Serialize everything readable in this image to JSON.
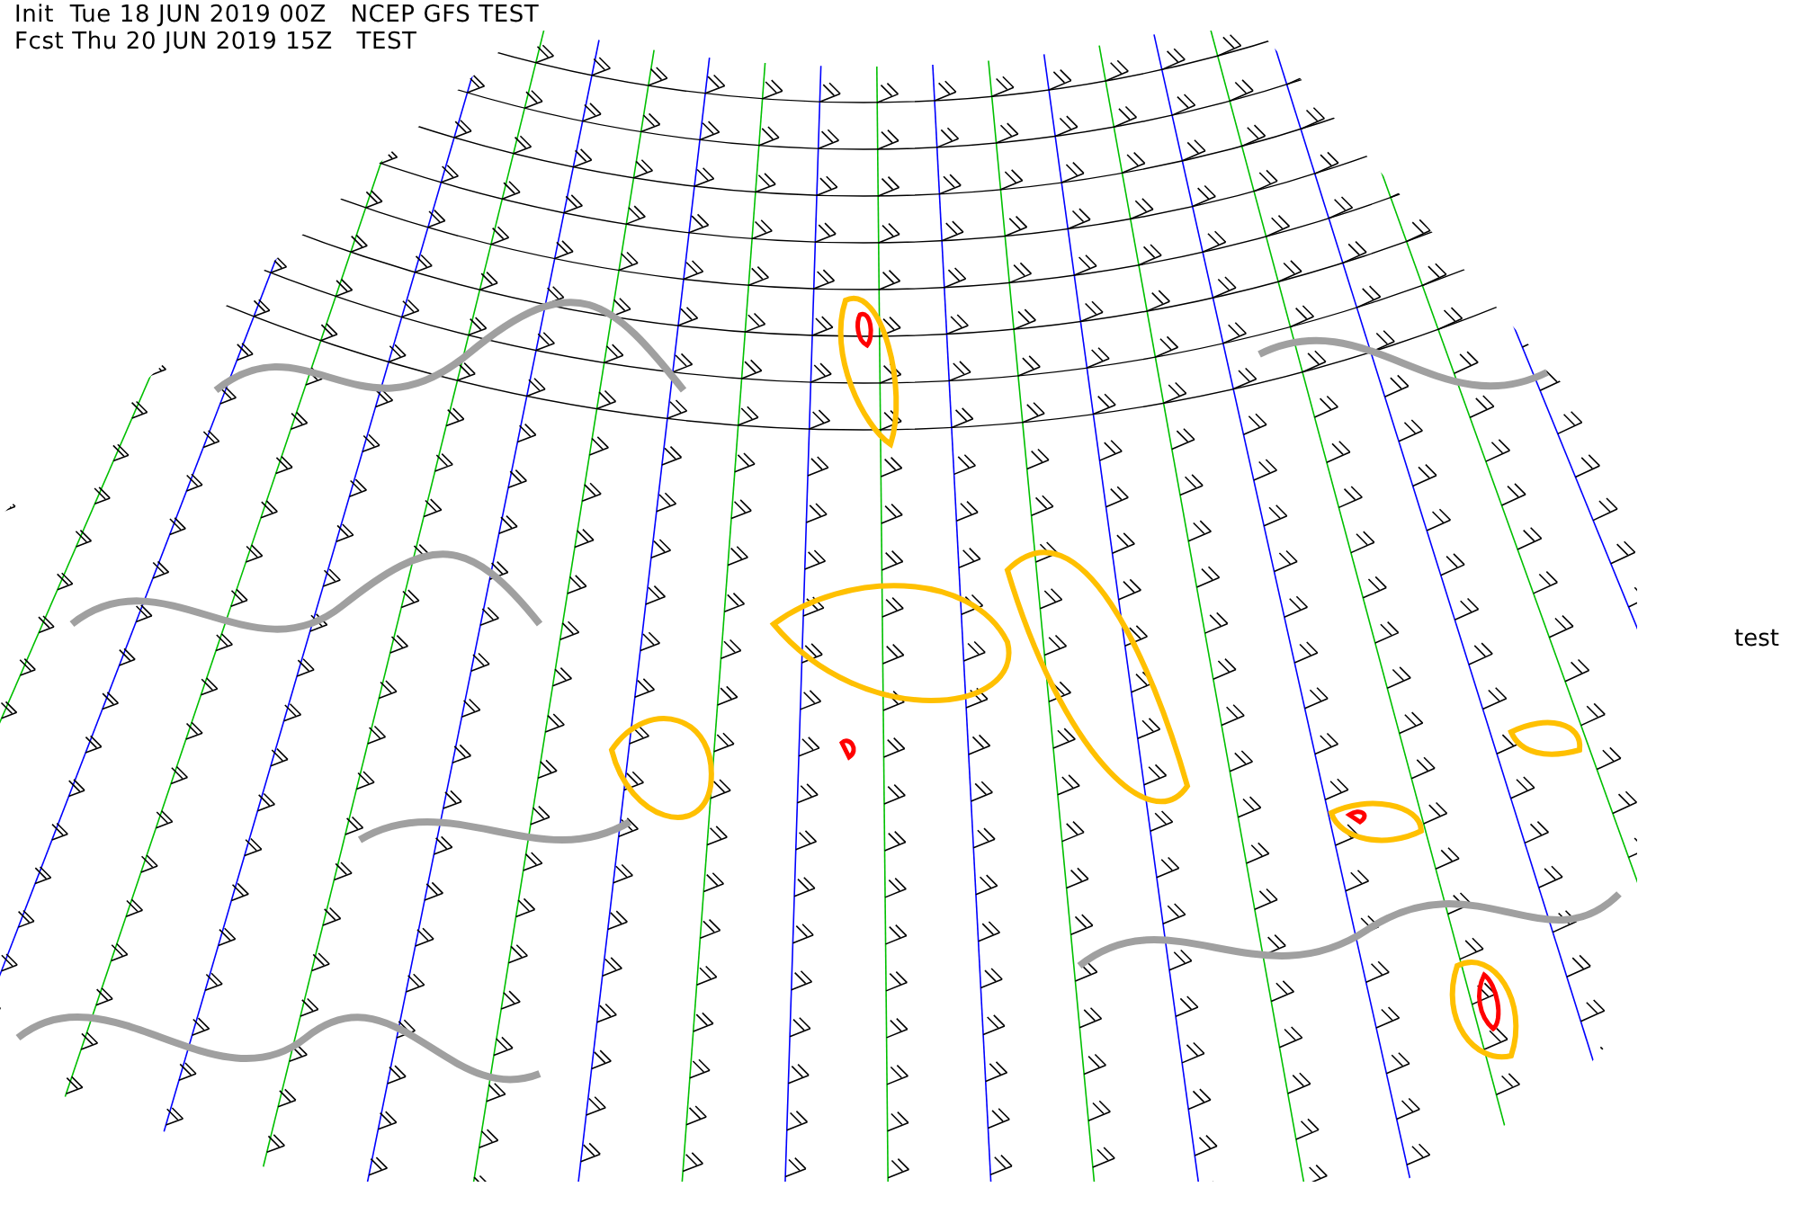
{
  "header": {
    "lines": [
      "Init  Tue 18 JUN 2019 00Z   NCEP GFS TEST",
      "Fcst Thu 20 JUN 2019 15Z   TEST"
    ]
  },
  "side_label": "test"
}
